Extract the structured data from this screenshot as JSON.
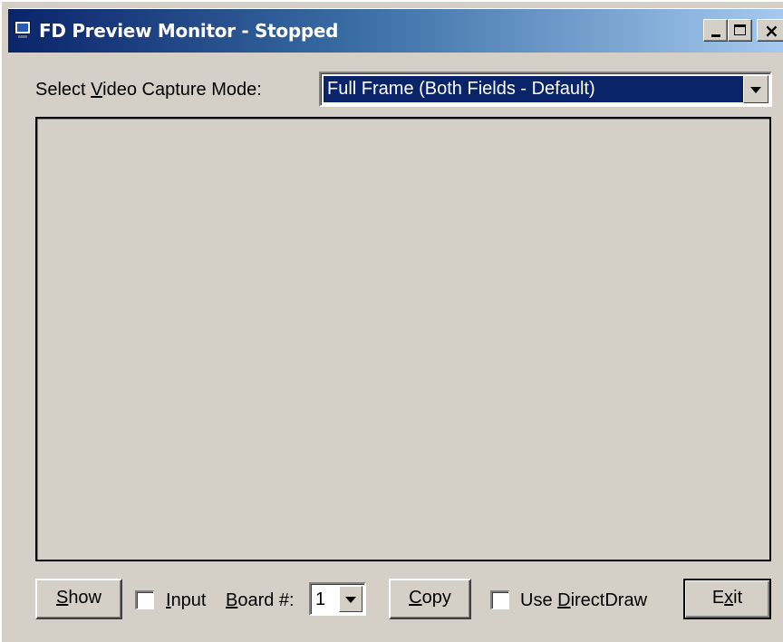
{
  "window": {
    "title": "FD Preview Monitor - Stopped",
    "controls": {
      "minimize": "_",
      "maximize": "□",
      "close": "×"
    }
  },
  "capture_mode": {
    "label_before": "Select ",
    "label_accel": "V",
    "label_after": "ideo Capture Mode:",
    "selected": "Full Frame (Both Fields - Default)"
  },
  "toolbar": {
    "show_accel": "S",
    "show_rest": "how",
    "input_accel": "I",
    "input_rest": "nput",
    "input_checked": false,
    "board_accel": "B",
    "board_rest": "oard #:",
    "board_value": "1",
    "copy_accel": "C",
    "copy_rest": "opy",
    "directdraw_before": "Use ",
    "directdraw_accel": "D",
    "directdraw_rest": "irectDraw",
    "directdraw_checked": false,
    "exit_before": "E",
    "exit_accel": "x",
    "exit_rest": "it"
  },
  "colors": {
    "face": "#d4d0c8",
    "title_active": "#0a246a",
    "selection": "#0a246a"
  },
  "icons": [
    "app-icon",
    "minimize-icon",
    "maximize-icon",
    "close-icon",
    "dropdown-arrow-icon"
  ]
}
